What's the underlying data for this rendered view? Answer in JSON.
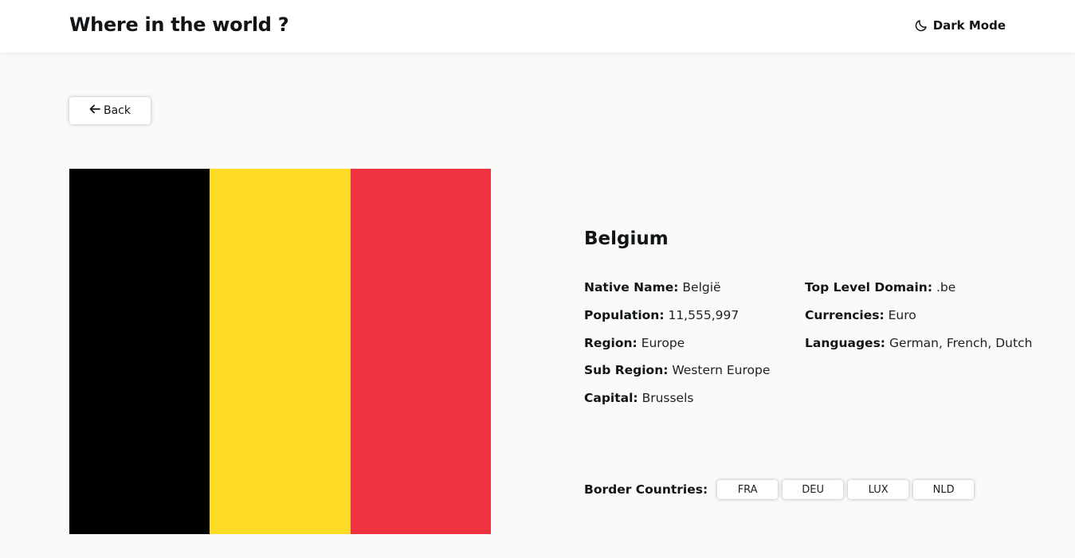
{
  "header": {
    "title": "Where in the world ?",
    "dark_mode_label": "Dark Mode",
    "dark_mode_icon": "moon-icon"
  },
  "nav": {
    "back_label": "Back",
    "back_icon": "arrow-left-icon"
  },
  "flag": {
    "colors": [
      "#000000",
      "#FDDA24",
      "#EF3340"
    ]
  },
  "country": {
    "name": "Belgium",
    "fields_left": [
      {
        "label": "Native Name:",
        "value": "België"
      },
      {
        "label": "Population:",
        "value": "11,555,997"
      },
      {
        "label": "Region:",
        "value": "Europe"
      },
      {
        "label": "Sub Region:",
        "value": "Western Europe"
      },
      {
        "label": "Capital:",
        "value": "Brussels"
      }
    ],
    "fields_right": [
      {
        "label": "Top Level Domain:",
        "value": ".be"
      },
      {
        "label": "Currencies:",
        "value": "Euro"
      },
      {
        "label": "Languages:",
        "value": "German, French, Dutch"
      }
    ],
    "border_label": "Border Countries:",
    "border_countries": [
      "FRA",
      "DEU",
      "LUX",
      "NLD"
    ]
  }
}
